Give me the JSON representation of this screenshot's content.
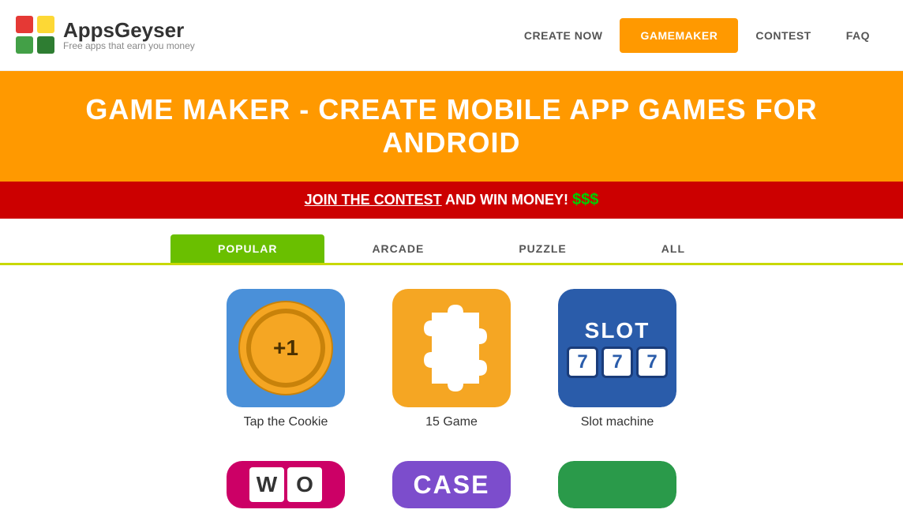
{
  "header": {
    "logo_title": "AppsGeyser",
    "logo_subtitle": "Free apps that earn you money",
    "nav": [
      {
        "id": "create-now",
        "label": "CREATE NOW",
        "active": false
      },
      {
        "id": "gamemaker",
        "label": "GAMEMAKER",
        "active": true
      },
      {
        "id": "contest",
        "label": "CONTEST",
        "active": false
      },
      {
        "id": "faq",
        "label": "FAQ",
        "active": false
      }
    ]
  },
  "hero": {
    "title": "GAME MAKER - CREATE MOBILE APP GAMES FOR ANDROID"
  },
  "contest_bar": {
    "link_text": "JOIN THE CONTEST",
    "rest_text": " AND WIN MONEY! ",
    "money": "$$$"
  },
  "tabs": [
    {
      "id": "popular",
      "label": "POPULAR",
      "active": true
    },
    {
      "id": "arcade",
      "label": "ARCADE",
      "active": false
    },
    {
      "id": "puzzle",
      "label": "PUZZLE",
      "active": false
    },
    {
      "id": "all",
      "label": "ALL",
      "active": false
    }
  ],
  "games_row1": [
    {
      "id": "tap-cookie",
      "title": "Tap the Cookie",
      "plus": "+1"
    },
    {
      "id": "fifteen-game",
      "title": "15 Game"
    },
    {
      "id": "slot-machine",
      "title": "Slot machine",
      "slot_label": "SLOT",
      "numbers": [
        "7",
        "7",
        "7"
      ]
    }
  ],
  "games_row2": [
    {
      "id": "word-game",
      "title": "",
      "letters": [
        "W",
        "O"
      ]
    },
    {
      "id": "case-game",
      "title": "",
      "case_label": "CASE"
    },
    {
      "id": "green-game",
      "title": ""
    }
  ]
}
